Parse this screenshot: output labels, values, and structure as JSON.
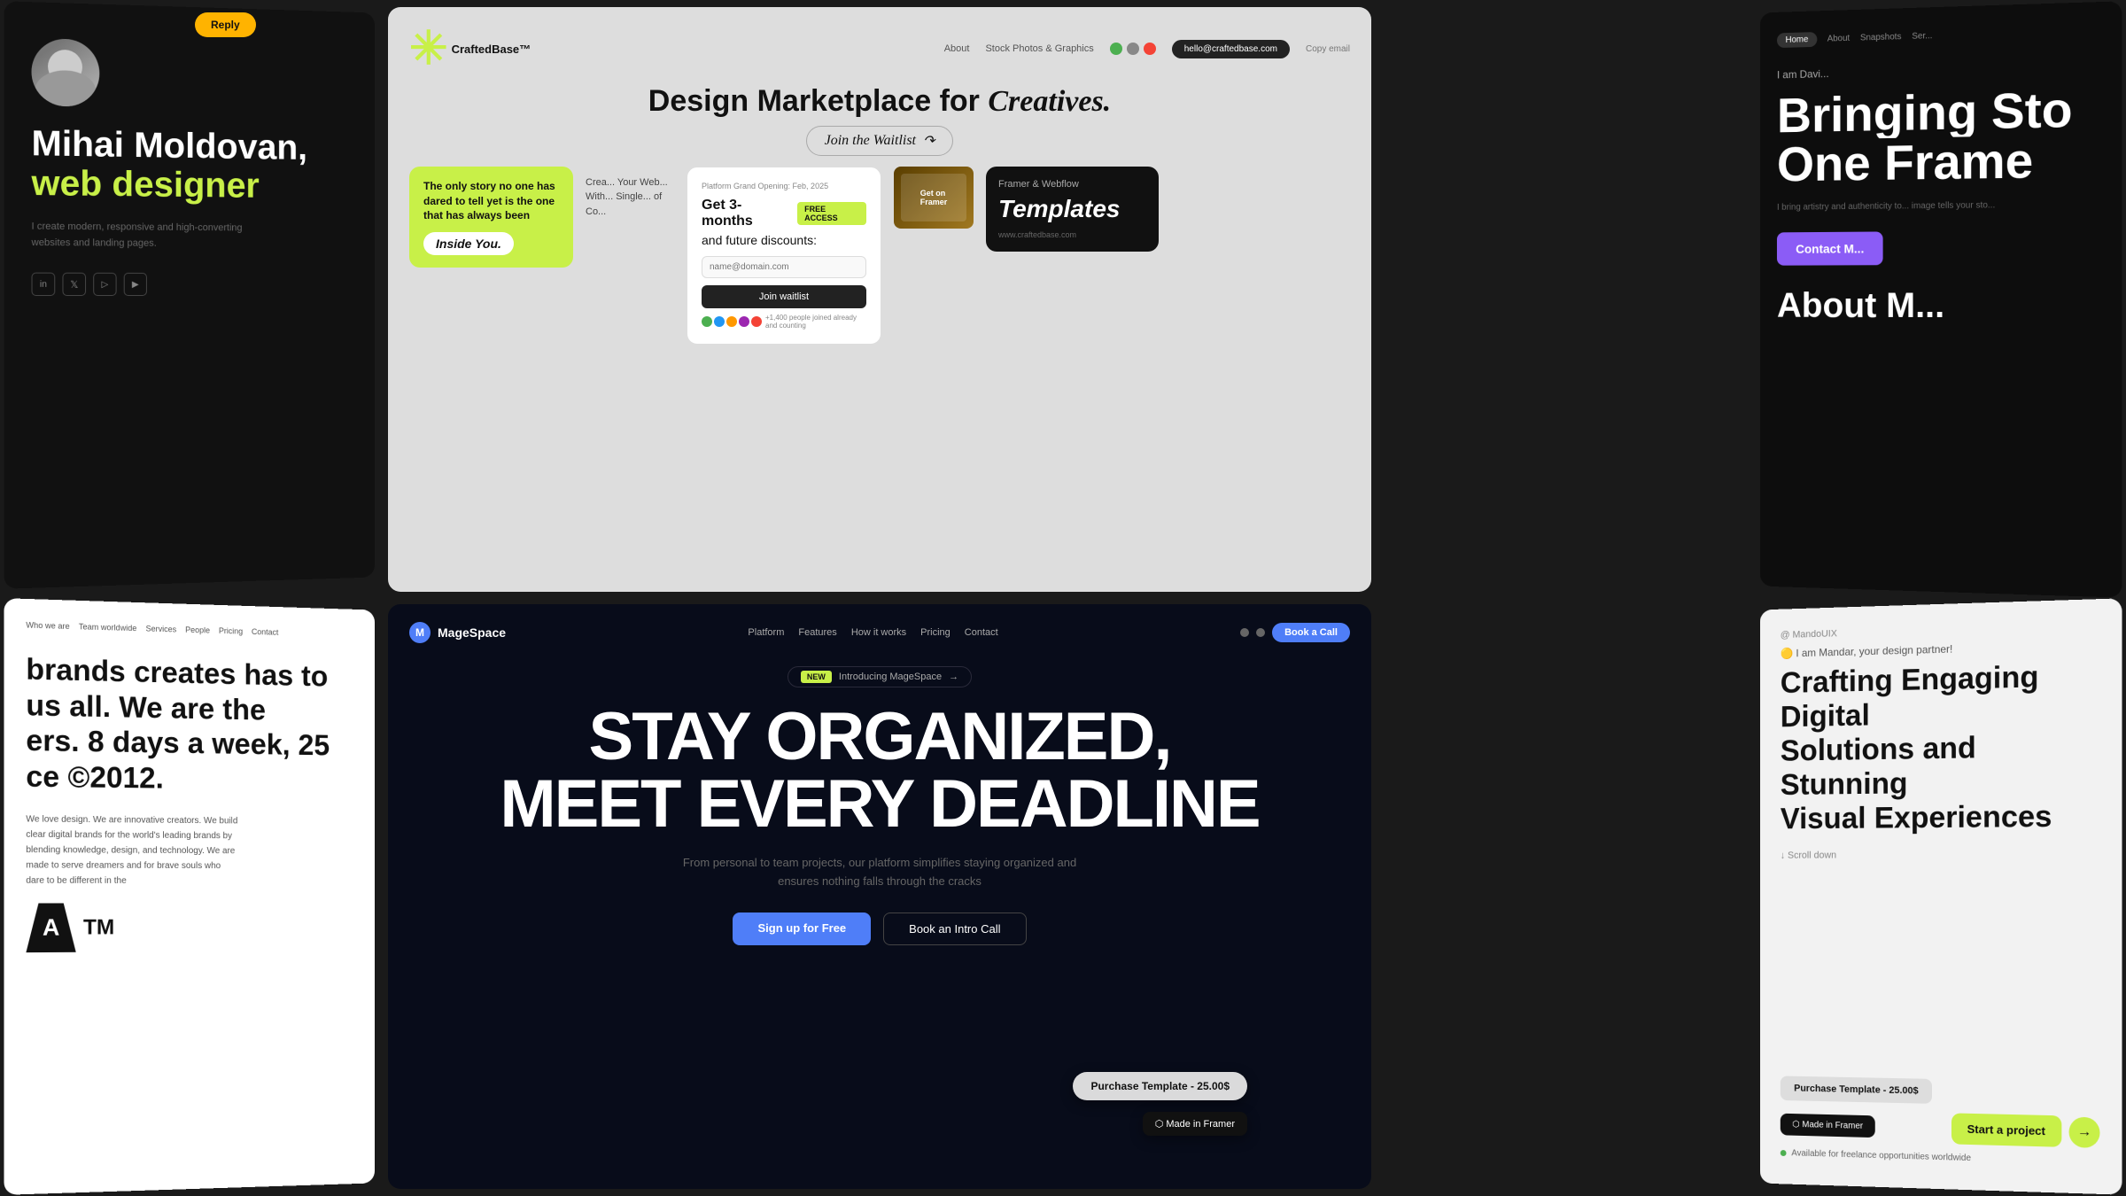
{
  "background": "#1a1a1a",
  "cards": {
    "mihai": {
      "name": "Mihai Moldovan,",
      "title": "web designer",
      "desc": "I create modern, responsive and high-converting websites and landing pages.",
      "social_links": [
        "in",
        "𝕏",
        "▷",
        "▶"
      ]
    },
    "craftedbase": {
      "brand": "CraftedBase™",
      "nav_items": [
        "About",
        "Stock Photos & Graphics"
      ],
      "email": "hello@craftedbase.com",
      "headline": "Design Marketplace for",
      "headline_italic": "Creatives.",
      "waitlist_label": "Join the Waitlist",
      "platform_label": "Platform Grand Opening: Feb, 2025",
      "get_months": "Get 3-months",
      "free_access": "FREE ACCESS",
      "future_discounts": "and future discounts:",
      "input_placeholder": "name@domain.com",
      "join_btn": "Join waitlist",
      "joined_text": "+1,400 people joined already and counting",
      "card_story": "The only story no one has dared to tell yet is the one that has always been",
      "inside_label": "Inside You.",
      "framer_webflow": "Framer & Webflow",
      "templates_text": "Templates",
      "website_label": "www.craftedbase.com"
    },
    "david": {
      "nav_items": [
        "Home",
        "About",
        "Snapshots",
        "Ser..."
      ],
      "intro": "I am Davi...",
      "headline1": "Bringing Sto",
      "headline2": "One Frame",
      "subtitle": "I bring artistry and authenticity to... image tells your sto...",
      "contact_btn": "Contact M...",
      "about_label": "About M..."
    },
    "atm": {
      "nav_items": [
        "Who we are",
        "Team worldwide",
        "Services",
        "People",
        "Pricing",
        "Contact"
      ],
      "headline": "brands creates has to us all. We are the ers. 8 days a week, 25 ce ©2012.",
      "body": "We love design. We are innovative creators. We build clear digital brands for the world's leading brands by blending knowledge, design, and technology. We are made to serve dreamers and for brave souls who dare to be different in the",
      "logo_letters": "ATM"
    },
    "magespace": {
      "brand": "MageSpace",
      "nav_items": [
        "Platform",
        "Features",
        "How it works",
        "Pricing",
        "Contact"
      ],
      "book_call_btn": "Book a Call",
      "new_badge": "NEW",
      "introducing": "Introducing MageSpace",
      "headline1": "STAY ORGANIZED,",
      "headline2": "MEET EVERY DEADLINE",
      "subtext": "From personal to team projects, our platform simplifies staying organized and ensures nothing falls through the cracks",
      "signup_btn": "Sign up for Free",
      "book_intro_btn": "Book an Intro Call",
      "purchase_template_btn": "Purchase Template - 25.00$",
      "framer_badge": "⬡ Made in Framer"
    },
    "mando": {
      "brand": "@ MandoUIX",
      "greeting": "🟡 I am Mandar, your design partner!",
      "headline1": "Crafting Engaging Digital",
      "headline2": "Solutions and Stunning",
      "headline3": "Visual Experiences",
      "scroll_down": "↓ Scroll down",
      "start_project_btn": "Start a project",
      "arrow": "→",
      "available_text": "Available for freelance opportunities worldwide"
    }
  }
}
